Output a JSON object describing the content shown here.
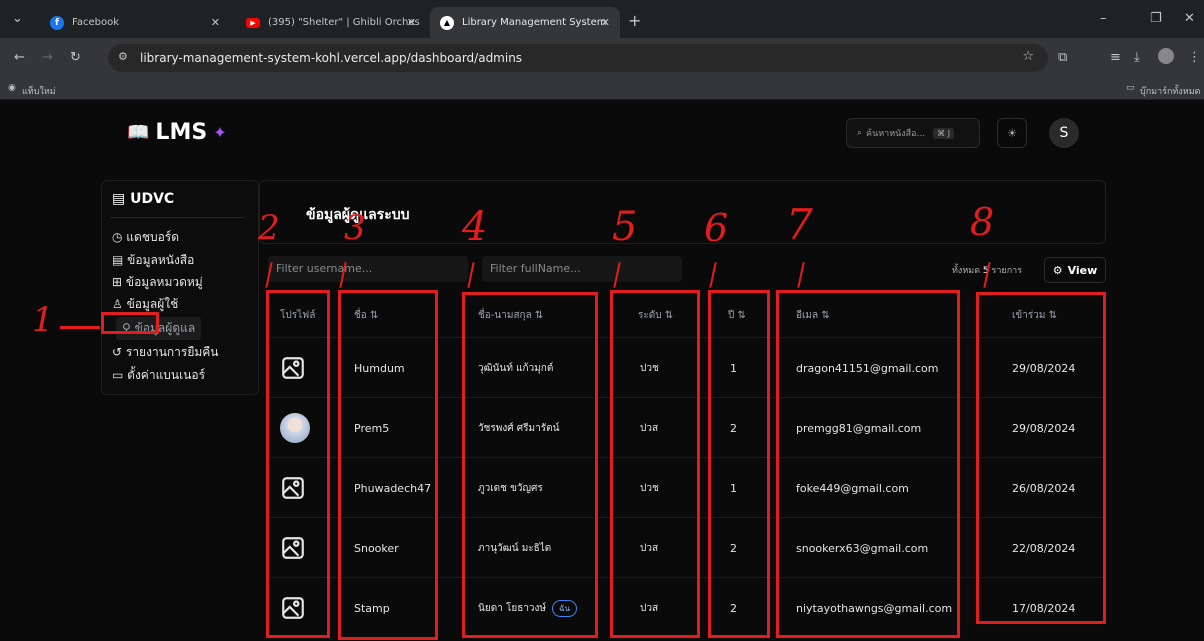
{
  "browser": {
    "tabs": [
      {
        "title": "Facebook",
        "icon": "facebook-icon"
      },
      {
        "title": "(395) \"Shelter\" | Ghibli Orches",
        "icon": "youtube-icon"
      },
      {
        "title": "Library Management System",
        "icon": "vercel-icon"
      }
    ],
    "url": "library-management-system-kohl.vercel.app/dashboard/admins",
    "bookmark_left": "แท็บใหม่",
    "bookmark_right": "บุ๊กมาร์กทั้งหมด"
  },
  "header": {
    "logo_text": "LMS",
    "search_placeholder": "ค้นหาหนังสือ...",
    "search_shortcut": "⌘ J",
    "avatar_letter": "S"
  },
  "sidebar": {
    "org": "UDVC",
    "items": [
      {
        "label": "แดชบอร์ด",
        "icon": "clock-icon"
      },
      {
        "label": "ข้อมูลหนังสือ",
        "icon": "book-icon"
      },
      {
        "label": "ข้อมูลหมวดหมู่",
        "icon": "grid-icon"
      },
      {
        "label": "ข้อมูลผู้ใช้",
        "icon": "user-icon"
      },
      {
        "label": "ข้อมูลผู้ดูแล",
        "icon": "users-icon"
      },
      {
        "label": "รายงานการยืมคืน",
        "icon": "history-icon"
      },
      {
        "label": "ตั้งค่าแบนเนอร์",
        "icon": "banner-icon"
      }
    ]
  },
  "main": {
    "title": "ข้อมูลผู้ดูแลระบบ",
    "filter_username": "Filter username...",
    "filter_fullname": "Filter fullName...",
    "total_label": "ทั้งหมด",
    "total_count": "5",
    "total_unit": "รายการ",
    "view_label": "View",
    "columns": [
      "โปรไฟล์",
      "ชื่อ",
      "ชื่อ-นามสกุล",
      "ระดับ",
      "ปี",
      "อีเมล",
      "เข้าร่วม"
    ],
    "rows": [
      {
        "name": "Humdum",
        "fullname": "วุฒินันท์ แก้วมุกต์",
        "level": "ปวช",
        "year": "1",
        "email": "dragon41151@gmail.com",
        "joined": "29/08/2024",
        "avatar": "image-icon",
        "badge": ""
      },
      {
        "name": "Prem5",
        "fullname": "วัชรพงศ์ ศรีมารัตน์",
        "level": "ปวส",
        "year": "2",
        "email": "premgg81@gmail.com",
        "joined": "29/08/2024",
        "avatar": "photo",
        "badge": ""
      },
      {
        "name": "Phuwadech47",
        "fullname": "ภูวเดช ขวัญศร",
        "level": "ปวช",
        "year": "1",
        "email": "foke449@gmail.com",
        "joined": "26/08/2024",
        "avatar": "image-icon",
        "badge": ""
      },
      {
        "name": "Snooker",
        "fullname": "ภานุวัฒน์ มะธิได",
        "level": "ปวส",
        "year": "2",
        "email": "snookerx63@gmail.com",
        "joined": "22/08/2024",
        "avatar": "image-icon",
        "badge": ""
      },
      {
        "name": "Stamp",
        "fullname": "นิยดา โยธาวงษ์",
        "level": "ปวส",
        "year": "2",
        "email": "niytayothawngs@gmail.com",
        "joined": "17/08/2024",
        "avatar": "image-icon",
        "badge": "ฉัน"
      }
    ]
  },
  "annotations": [
    "1",
    "2",
    "3",
    "4",
    "5",
    "6",
    "7",
    "8"
  ],
  "colors": {
    "annotation": "#e11d1d",
    "accent": "#3b82f6",
    "background": "#0a0a0a"
  }
}
